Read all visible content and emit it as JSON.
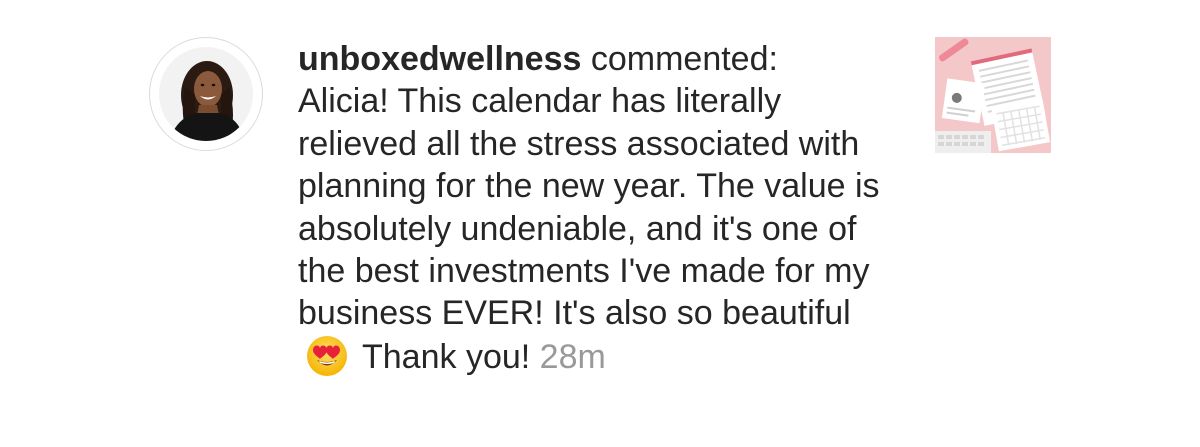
{
  "notification": {
    "username": "unboxedwellness",
    "action": "commented:",
    "comment_before_emoji": "Alicia! This calendar has literally relieved all the stress associated with planning for the new year. The value is absolutely undeniable, and it's one of the best investments I've made for my business EVER! It's also so beautiful",
    "emoji": "heart-eyes-emoji",
    "comment_after_emoji": "Thank you!",
    "timestamp": "28m"
  },
  "colors": {
    "text": "#262626",
    "timestamp": "#999999",
    "avatar_ring": "#dbdbdb",
    "thumb_background": "#f4c7c8"
  }
}
